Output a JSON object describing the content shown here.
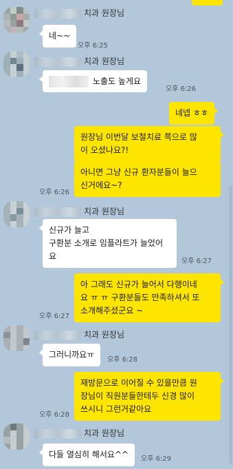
{
  "messages": [
    {
      "sender_suffix": "치과 원장님",
      "text": "네~~",
      "time": "오후 6:25"
    },
    {
      "sender_suffix": "치과 원장님",
      "text": "노출도 높게요",
      "time": "오후 6:26"
    },
    {
      "text": "네넵 ㅎㅎ"
    },
    {
      "text": "원장님 이번달 보철치료 쪽으로 많\n이 오셨나요?!"
    },
    {
      "text": "아니면 그냥 신규 환자분들이 늘으\n신거에요~?",
      "time": "오후 6:26"
    },
    {
      "sender_suffix": "치과 원장님",
      "text": "신규가 늘고\n구환분 소개로 임플라트가 늘었어\n요",
      "time": "오후 6:27"
    },
    {
      "text": "아 그래도 신규가 늘어서 다행이네\n요 ㅠ ㅠ 구환분들도 만족하셔서 또\n소개해주셨군요 ~",
      "time": "오후 6:27"
    },
    {
      "sender_suffix": "치과 원장님",
      "text": "그러니까요ㅠ",
      "time": "오후 6:28"
    },
    {
      "text": "재방문으로 이어질 수 있을만큼 원\n장님이 직원분들한테두 신경 많이\n쓰시니 그런거같아요",
      "time": "오후 6:28"
    },
    {
      "sender_suffix": "치과 원장님",
      "text": "다들 열심히 해서요^^",
      "time": "오후 6:29"
    }
  ]
}
